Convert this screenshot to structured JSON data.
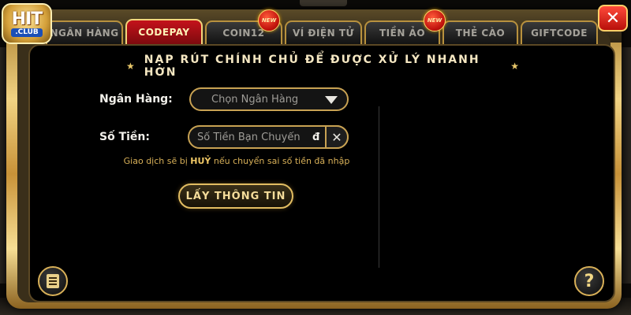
{
  "logo": {
    "main": "HIT",
    "sub": ".CLUB"
  },
  "tabs": [
    {
      "label": "NGÂN HÀNG",
      "active": false,
      "is_new": false
    },
    {
      "label": "CODEPAY",
      "active": true,
      "is_new": false
    },
    {
      "label": "COIN12",
      "active": false,
      "is_new": true
    },
    {
      "label": "VÍ ĐIỆN TỬ",
      "active": false,
      "is_new": false
    },
    {
      "label": "TIỀN ẢO",
      "active": false,
      "is_new": true
    },
    {
      "label": "THẺ CÀO",
      "active": false,
      "is_new": false
    },
    {
      "label": "GIFTCODE",
      "active": false,
      "is_new": false
    }
  ],
  "new_badge": "NEW",
  "close_symbol": "✕",
  "heading": "NẠP RÚT CHÍNH CHỦ ĐỂ ĐƯỢC XỬ LÝ NHANH HƠN",
  "heading_star": "★",
  "form": {
    "bank_label": "Ngân Hàng:",
    "bank_select_value": "Chọn Ngân Hàng",
    "amount_label": "Số Tiền:",
    "amount_placeholder": "Số Tiền Bạn Chuyển",
    "amount_unit": "đ",
    "clear_symbol": "✕"
  },
  "warning": {
    "prefix": "Giao dịch sẽ bị ",
    "emphasis": "HUỶ",
    "suffix": " nếu chuyển sai số tiền đã nhập"
  },
  "info_button": "LẤY THÔNG TIN",
  "help_symbol": "?",
  "icons": {
    "close": "close-icon",
    "clear": "clear-icon",
    "dropdown": "chevron-down-icon",
    "history": "document-icon",
    "help": "question-mark-icon"
  },
  "colors": {
    "gold": "#d8b058",
    "active_tab": "#c4121b",
    "panel_bg": "#000000"
  }
}
